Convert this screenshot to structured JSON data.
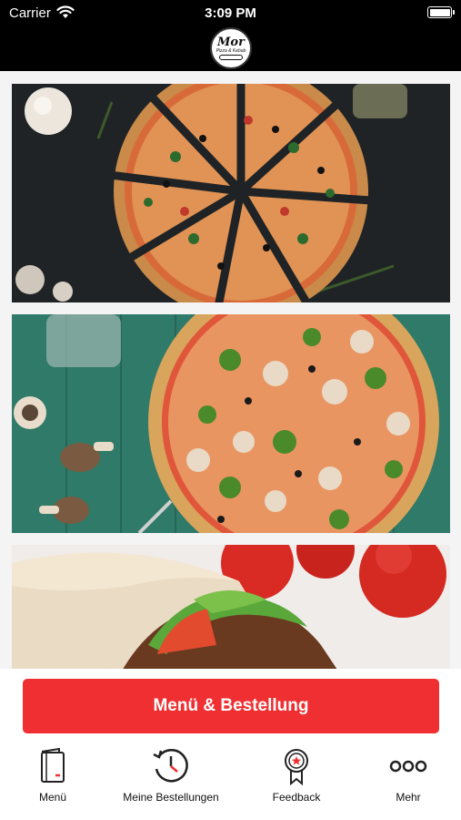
{
  "status_bar": {
    "carrier": "Carrier",
    "time": "3:09 PM"
  },
  "header": {
    "logo_text": "Mor",
    "logo_subtext": "Pizza & Kebab"
  },
  "cards": [
    {
      "id": "pizza-dark-board-image"
    },
    {
      "id": "pizza-green-table-image"
    },
    {
      "id": "kebab-wrap-image"
    }
  ],
  "order_button": {
    "label": "Menü & Bestellung",
    "color": "#ef2f31"
  },
  "tabbar": {
    "items": [
      {
        "label": "Menü",
        "icon": "menu-book-icon"
      },
      {
        "label": "Meine Bestellungen",
        "icon": "order-history-icon"
      },
      {
        "label": "Feedback",
        "icon": "feedback-badge-icon"
      },
      {
        "label": "Mehr",
        "icon": "more-dots-icon"
      }
    ]
  }
}
